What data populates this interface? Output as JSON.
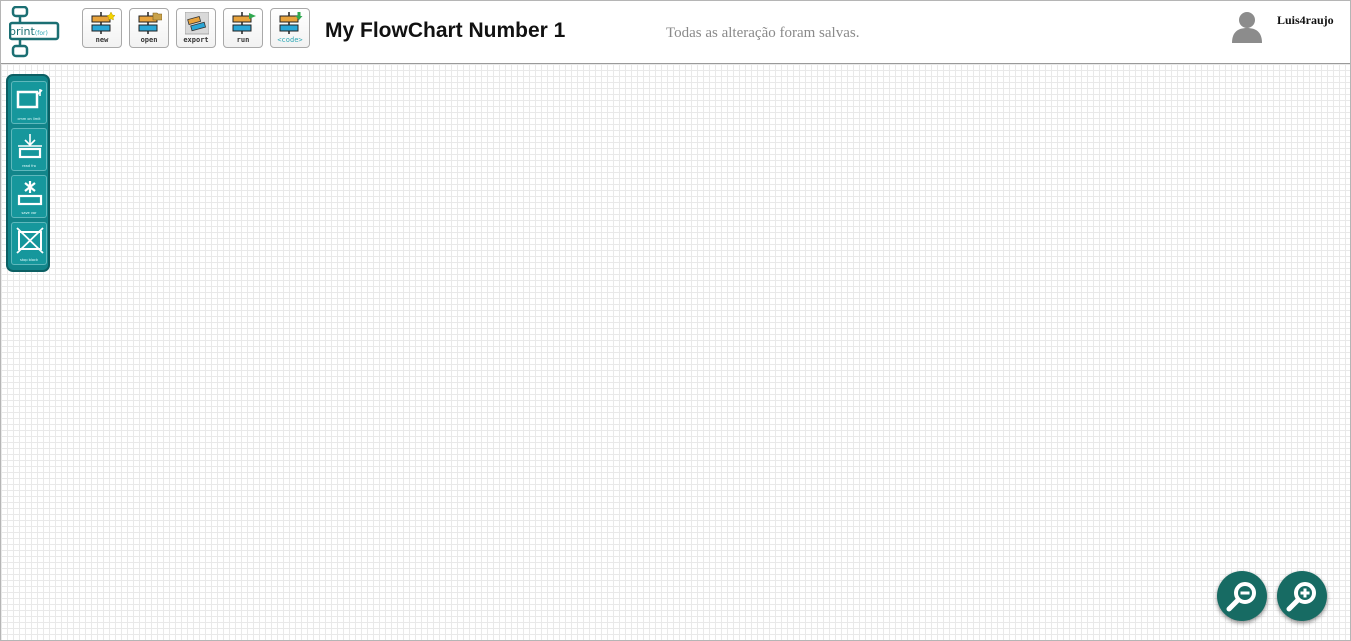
{
  "app": {
    "logo_text": "print",
    "logo_suffix": "(for)"
  },
  "toolbar": {
    "buttons": [
      {
        "label": "new",
        "icon": "new-flowchart-icon"
      },
      {
        "label": "open",
        "icon": "open-folder-icon"
      },
      {
        "label": "export",
        "icon": "export-icon"
      },
      {
        "label": "run",
        "icon": "run-arrow-icon"
      },
      {
        "label": "<code>",
        "icon": "code-download-icon"
      }
    ]
  },
  "document": {
    "title": "My FlowChart Number 1",
    "save_status": "Todas as alteração foram salvas."
  },
  "user": {
    "name": "Luis4raujo",
    "avatar_icon": "user-avatar-icon"
  },
  "palette": {
    "items": [
      {
        "label": "cmm on limit",
        "icon": "output-block-icon"
      },
      {
        "label": "read fro",
        "icon": "input-block-icon"
      },
      {
        "label": "save var",
        "icon": "assign-block-icon"
      },
      {
        "label": "stop block",
        "icon": "stop-block-icon"
      }
    ]
  },
  "zoom": {
    "out_icon": "zoom-out-icon",
    "in_icon": "zoom-in-icon"
  },
  "colors": {
    "palette_bg": "#12858a",
    "zoom_bg": "#176b63",
    "logo": "#1b6f73",
    "accent_orange": "#e8a33c",
    "accent_blue": "#2aa6d6"
  }
}
